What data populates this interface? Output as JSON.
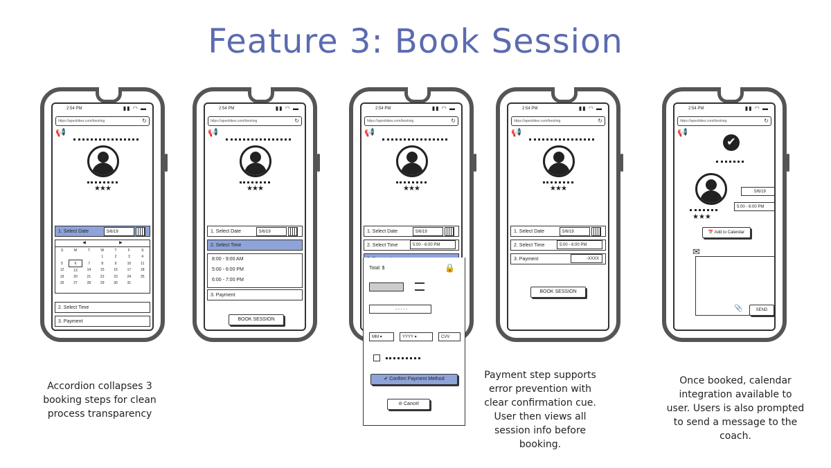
{
  "title": "Feature 3: Book Session",
  "status_time": "2:54 PM",
  "url_text": "https://apexbikes.com/booking",
  "steps": {
    "select_date": "1. Select Date",
    "select_time": "2. Select Time",
    "payment": "3. Payment"
  },
  "date_value": "5/6/19",
  "time_value": "5:00 - 6:00 PM",
  "time_options": [
    "8:00 - 9:00 AM",
    "5:00 - 6:00 PM",
    "6:00 - 7:00 PM"
  ],
  "calendar": {
    "days": [
      "S",
      "M",
      "T",
      "W",
      "T",
      "F",
      "S"
    ],
    "weeks": [
      [
        "",
        "",
        "",
        "1",
        "2",
        "3",
        "4"
      ],
      [
        "5",
        "6",
        "7",
        "8",
        "9",
        "10",
        "11"
      ],
      [
        "12",
        "13",
        "14",
        "15",
        "16",
        "17",
        "18"
      ],
      [
        "19",
        "20",
        "21",
        "22",
        "23",
        "24",
        "25"
      ],
      [
        "26",
        "27",
        "28",
        "29",
        "30",
        "31",
        ""
      ]
    ]
  },
  "payment": {
    "total_label": "Total: $",
    "mm": "MM",
    "yyyy": "YYYY",
    "cvv": "CVV",
    "card_placeholder": "- - - - -",
    "confirm_label": "Confirm Payment Method",
    "cancel_label": "Cancel"
  },
  "masked_payment": "-XXXX",
  "book_session_label": "BOOK SESSION",
  "add_to_calendar_label": "Add to Calendar",
  "send_label": "SEND",
  "captions": {
    "c1": "Accordion collapses 3 booking steps for clean process transparency",
    "c2": "Payment step supports error prevention with clear confirmation cue. User then views all session info before booking.",
    "c3": "Once booked, calendar integration available to user. Users is also prompted to send a message to the coach."
  },
  "colors": {
    "accent": "#8ea3d8",
    "title": "#5b6bb0",
    "frame": "#555555"
  }
}
